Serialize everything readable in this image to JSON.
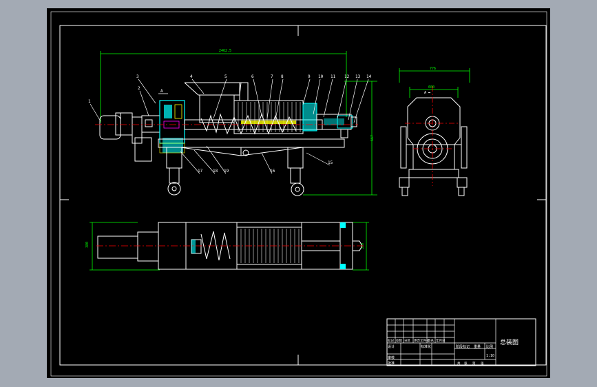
{
  "drawing": {
    "part_numbers": [
      "1",
      "2",
      "3",
      "4",
      "5",
      "6",
      "7",
      "8",
      "9",
      "10",
      "11",
      "12",
      "13",
      "14",
      "15",
      "16",
      "17",
      "18",
      "19"
    ],
    "dim_overall_length": "2462.5",
    "dim_height": "667",
    "dim_side_width": "776",
    "dim_side_inner_width": "600",
    "dim_plan_width": "380",
    "dim_plan_right": "310",
    "section_label": "A"
  },
  "title_block": {
    "title": "总装图",
    "row_labels": [
      "标记",
      "处数",
      "分区",
      "更改文件号",
      "签名",
      "年月日"
    ],
    "designer_label": "设计",
    "standard_label": "标准化",
    "approve_label": "批准",
    "check_label": "审核",
    "stage_label": "阶段标记",
    "weight_label": "重量",
    "scale_label": "比例",
    "scale_value": "1:10",
    "sheet_labels": [
      "共",
      "张",
      "第",
      "张"
    ]
  },
  "colors": {
    "background": "#a3aab4",
    "sheet": "#000000",
    "frame": "#ffffff",
    "dimension": "#00ff00",
    "centerline": "#ff0000",
    "part": "#ffffff",
    "highlight": "#00ffff",
    "accent": "#ffff00"
  }
}
